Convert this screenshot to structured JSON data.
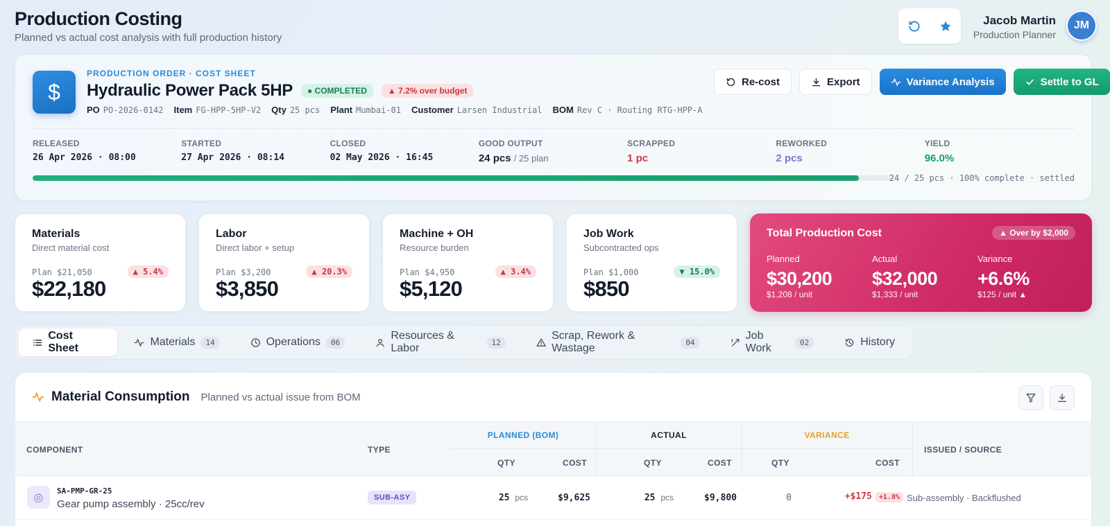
{
  "header": {
    "title": "Production Costing",
    "subtitle": "Planned vs actual cost analysis with full production history",
    "user_name": "Jacob Martin",
    "user_role": "Production Planner",
    "avatar_initials": "JM"
  },
  "order": {
    "eyebrow": "PRODUCTION ORDER · COST SHEET",
    "title": "Hydraulic Power Pack 5HP",
    "status": "COMPLETED",
    "budget_badge": "▲ 7.2% over budget",
    "meta": [
      {
        "key": "PO",
        "value": "PO-2026-0142"
      },
      {
        "key": "Item",
        "value": "FG-HPP-5HP-V2"
      },
      {
        "key": "Qty",
        "value": "25 pcs"
      },
      {
        "key": "Plant",
        "value": "Mumbai-01"
      },
      {
        "key": "Customer",
        "value": "Larsen Industrial"
      },
      {
        "key": "BOM",
        "value": "Rev C · Routing RTG-HPP-A"
      }
    ],
    "actions": {
      "recost": "Re-cost",
      "export": "Export",
      "variance": "Variance Analysis",
      "settle": "Settle to GL"
    },
    "stats": {
      "released_label": "RELEASED",
      "released_value": "26 Apr 2026 · 08:00",
      "started_label": "STARTED",
      "started_value": "27 Apr 2026 · 08:14",
      "closed_label": "CLOSED",
      "closed_value": "02 May 2026 · 16:45",
      "good_label": "GOOD OUTPUT",
      "good_value": "24 pcs",
      "good_plan": "/ 25 plan",
      "scrapped_label": "SCRAPPED",
      "scrapped_value": "1 pc",
      "reworked_label": "REWORKED",
      "reworked_value": "2 pcs",
      "yield_label": "YIELD",
      "yield_value": "96.0%"
    },
    "progress_fraction": 0.96,
    "progress_label": "24 / 25 pcs · 100% complete · settled"
  },
  "kpis": [
    {
      "title": "Materials",
      "sub": "Direct material cost",
      "plan": "Plan $21,050",
      "badge": "▲ 5.4%",
      "value": "$22,180"
    },
    {
      "title": "Labor",
      "sub": "Direct labor + setup",
      "plan": "Plan $3,200",
      "badge": "▲ 20.3%",
      "value": "$3,850"
    },
    {
      "title": "Machine + OH",
      "sub": "Resource burden",
      "plan": "Plan $4,950",
      "badge": "▲ 3.4%",
      "value": "$5,120"
    },
    {
      "title": "Job Work",
      "sub": "Subcontracted ops",
      "plan": "Plan $1,000",
      "badge": "▼ 15.0%",
      "value": "$850"
    }
  ],
  "total": {
    "title": "Total Production Cost",
    "badge": "▲ Over by $2,000",
    "planned_label": "Planned",
    "planned_value": "$30,200",
    "planned_unit": "$1,208 / unit",
    "actual_label": "Actual",
    "actual_value": "$32,000",
    "actual_unit": "$1,333 / unit",
    "variance_label": "Variance",
    "variance_value": "+6.6%",
    "variance_unit": "$125 / unit ▲"
  },
  "tabs": [
    {
      "label": "Cost Sheet",
      "count": ""
    },
    {
      "label": "Materials",
      "count": "14"
    },
    {
      "label": "Operations",
      "count": "06"
    },
    {
      "label": "Resources & Labor",
      "count": "12"
    },
    {
      "label": "Scrap, Rework & Wastage",
      "count": "04"
    },
    {
      "label": "Job Work",
      "count": "02"
    },
    {
      "label": "History",
      "count": ""
    }
  ],
  "panel": {
    "title": "Material Consumption",
    "subtitle": "Planned vs actual issue from BOM",
    "columns": {
      "component": "COMPONENT",
      "type": "TYPE",
      "planned": "PLANNED (BOM)",
      "actual": "ACTUAL",
      "variance": "VARIANCE",
      "qty": "QTY",
      "cost": "COST",
      "issued": "ISSUED / SOURCE"
    },
    "rows": [
      {
        "code": "SA-PMP-GR-25",
        "name": "Gear pump assembly · 25cc/rev",
        "type": "SUB-ASY",
        "plan_qty": "25",
        "unit": "pcs",
        "plan_cost": "$9,625",
        "act_qty": "25",
        "act_cost": "$9,800",
        "var_qty": "0",
        "var_cost": "+$175",
        "var_pct": "+1.8%",
        "source": "Sub-assembly · Backflushed"
      }
    ]
  },
  "colors": {
    "accent_blue": "#2a8ad6",
    "green": "#17a06f",
    "red": "#d23545",
    "total_card": "#d62f6b"
  }
}
